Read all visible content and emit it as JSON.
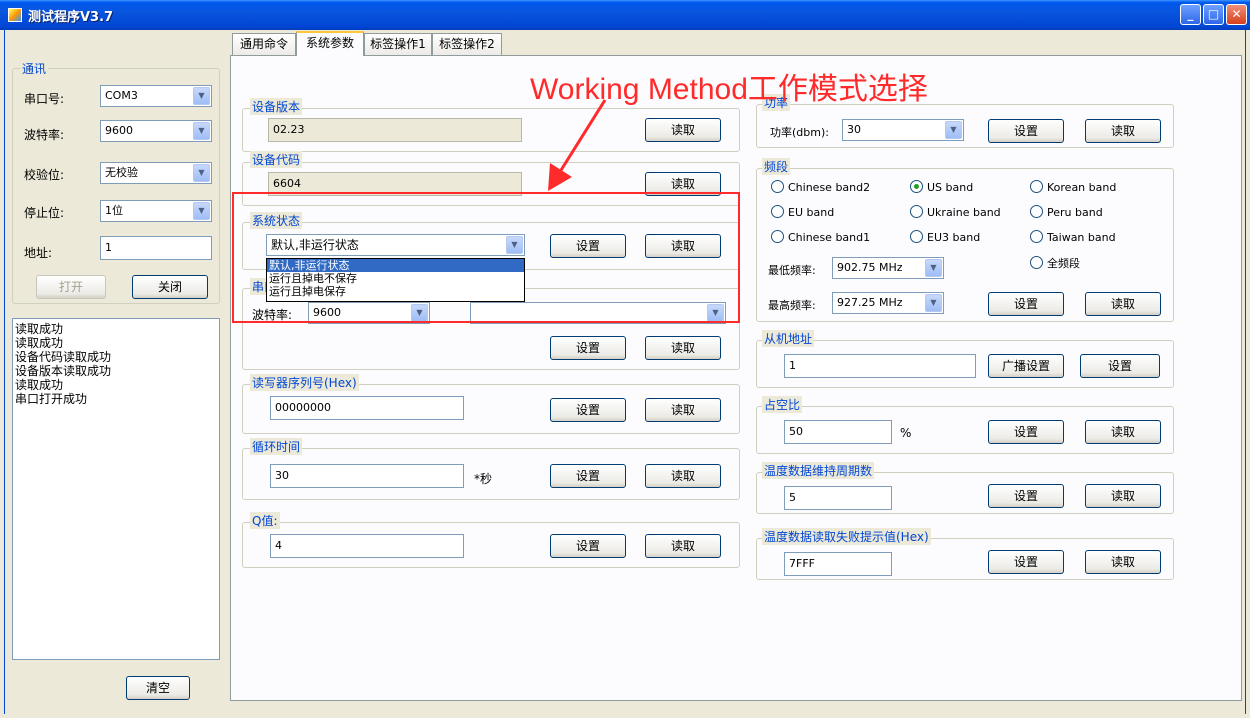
{
  "window": {
    "title": "测试程序V3.7"
  },
  "comm": {
    "group_label": "通讯",
    "port_label": "串口号:",
    "port_value": "COM3",
    "baud_label": "波特率:",
    "baud_value": "9600",
    "parity_label": "校验位:",
    "parity_value": "无校验",
    "stop_label": "停止位:",
    "stop_value": "1位",
    "addr_label": "地址:",
    "addr_value": "1",
    "open_button": "打开",
    "close_button": "关闭"
  },
  "log": {
    "lines": [
      "读取成功",
      "读取成功",
      "设备代码读取成功",
      "设备版本读取成功",
      "读取成功",
      "串口打开成功"
    ],
    "clear_button": "清空"
  },
  "tabs": [
    "通用命令",
    "系统参数",
    "标签操作1",
    "标签操作2"
  ],
  "common": {
    "read": "读取",
    "set": "设置"
  },
  "left_panel": {
    "version_label": "设备版本",
    "version_value": "02.23",
    "code_label": "设备代码",
    "code_value": "6604",
    "state_label": "系统状态",
    "state_value": "默认,非运行状态",
    "state_options": [
      "默认,非运行状态",
      "运行且掉电不保存",
      "运行且掉电保存"
    ],
    "serial_label": "串口",
    "serial_baud_label": "波特率:",
    "serial_baud_value": "9600",
    "reader_sn_label": "读写器序列号(Hex)",
    "reader_sn_value": "00000000",
    "cycle_label": "循环时间",
    "cycle_value": "30",
    "cycle_unit": "*秒",
    "q_label": "Q值:",
    "q_value": "4"
  },
  "right_panel": {
    "power_label": "功率",
    "power_field_label": "功率(dbm):",
    "power_value": "30",
    "band_label": "频段",
    "bands": [
      {
        "label": "Chinese band2",
        "checked": false
      },
      {
        "label": "US band",
        "checked": true
      },
      {
        "label": "Korean band",
        "checked": false
      },
      {
        "label": "EU band",
        "checked": false
      },
      {
        "label": "Ukraine band",
        "checked": false
      },
      {
        "label": "Peru band",
        "checked": false
      },
      {
        "label": "Chinese band1",
        "checked": false
      },
      {
        "label": "EU3 band",
        "checked": false
      },
      {
        "label": "Taiwan band",
        "checked": false
      }
    ],
    "full_band_label": "全频段",
    "min_freq_label": "最低频率:",
    "min_freq_value": "902.75 MHz",
    "max_freq_label": "最高频率:",
    "max_freq_value": "927.25 MHz",
    "slave_addr_label": "从机地址",
    "slave_addr_value": "1",
    "broadcast_button": "广播设置",
    "duty_label": "占空比",
    "duty_value": "50",
    "duty_unit": "%",
    "temp_period_label": "温度数据维持周期数",
    "temp_period_value": "5",
    "temp_fail_label": "温度数据读取失败提示值(Hex)",
    "temp_fail_value": "7FFF"
  },
  "annotation": {
    "text": "Working Method工作模式选择",
    "color": "#ff2a2a"
  }
}
